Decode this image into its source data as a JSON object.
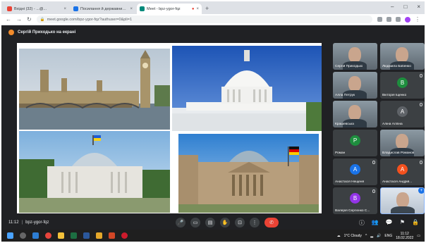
{
  "browser": {
    "tabs": [
      {
        "title": "Вхідні (32) - ...@...",
        "favicon_color": "#ea4335",
        "active": false
      },
      {
        "title": "Посилання й державний ...",
        "favicon_color": "#1a73e8",
        "active": false
      },
      {
        "title": "Meet - bpz-ygor-fqz",
        "favicon_color": "#00897b",
        "active": true
      }
    ],
    "new_tab": "+",
    "url": "meet.google.com/bpz-ygor-fqz?authuser=0&pli=1"
  },
  "meet": {
    "presenter_label": "Сергій Приходько на екрані",
    "time": "11:12",
    "meeting_code": "bpz-ygor-fqz"
  },
  "participants": [
    {
      "name": "Сергій Приходько",
      "type": "video"
    },
    {
      "name": "Людмила Бабенко",
      "type": "video"
    },
    {
      "name": "Алла Петрук",
      "type": "video"
    },
    {
      "name": "Вікторія Іщенко",
      "type": "avatar",
      "initial": "В",
      "color": "#1e8e3e"
    },
    {
      "name": "Крашевська",
      "type": "video"
    },
    {
      "name": "Аліна Алпіна",
      "type": "avatar",
      "initial": "A",
      "color": "#5f6368"
    },
    {
      "name": "Роман",
      "type": "avatar",
      "initial": "P",
      "color": "#1e8e3e"
    },
    {
      "name": "Владислав Романов",
      "type": "video"
    },
    {
      "name": "Анастасія Нещеня",
      "type": "avatar",
      "initial": "A",
      "color": "#1a73e8"
    },
    {
      "name": "Анастасія Андрій...",
      "type": "avatar",
      "initial": "A",
      "color": "#f4511e"
    },
    {
      "name": "Валерія Сергієнко С...",
      "type": "avatar",
      "initial": "B",
      "color": "#9334e6"
    },
    {
      "name": "",
      "type": "self"
    }
  ],
  "taskbar": {
    "weather": "1°C Cloudy",
    "lang": "ENG",
    "time": "11:12",
    "date": "18.02.2022"
  }
}
